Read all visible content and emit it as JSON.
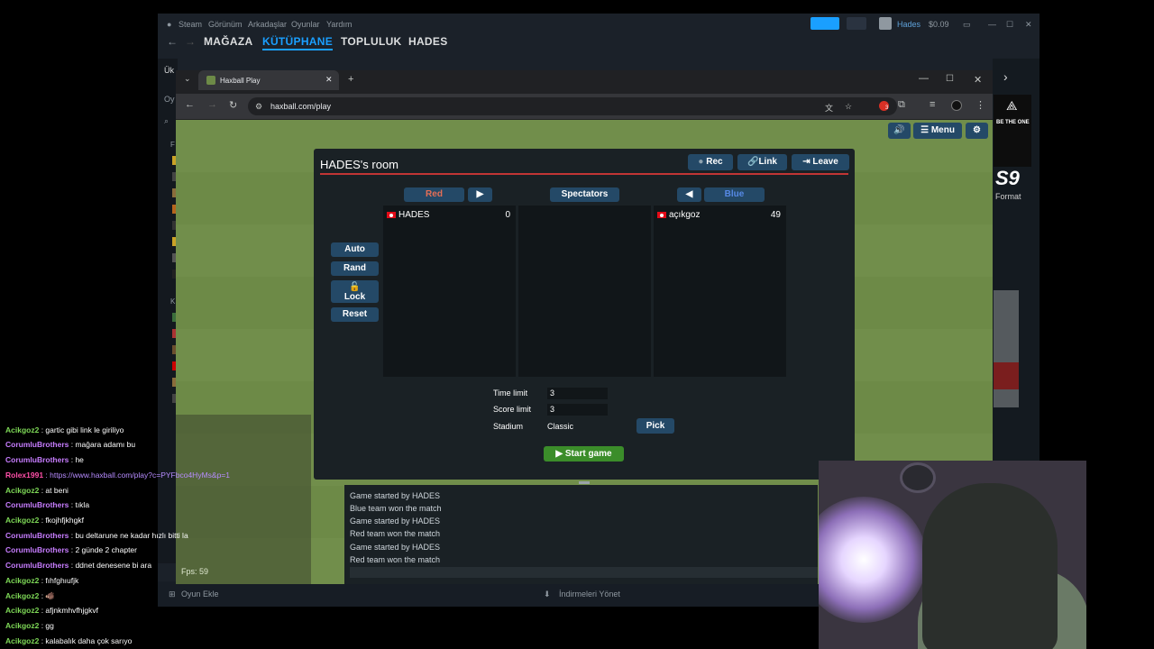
{
  "steam": {
    "menu": [
      "Steam",
      "Görünüm",
      "Arkadaşlar",
      "Oyunlar",
      "Yardım"
    ],
    "nav": [
      "MAĞAZA",
      "KÜTÜPHANE",
      "TOPLULUK",
      "HADES"
    ],
    "user": "Hades",
    "balance": "$0.09",
    "add_game": "Oyun Ekle",
    "downloads": "İndirmeleri Yönet",
    "home_tab": "Ük",
    "side_label_a": "Oy",
    "side_label_b": "F",
    "side_label_c": "K"
  },
  "chrome": {
    "tab_title": "Haxball Play",
    "url": "haxball.com/play",
    "ext_badge": "3"
  },
  "haxball": {
    "top_menu": "Menu",
    "room_title": "HADES's room",
    "rec": "Rec",
    "link": "Link",
    "leave": "Leave",
    "red_label": "Red",
    "blue_label": "Blue",
    "spectators_label": "Spectators",
    "arrow_right": "▶",
    "arrow_left": "◀",
    "red_players": [
      {
        "name": "HADES",
        "score": "0"
      }
    ],
    "blue_players": [
      {
        "name": "açıkgoz",
        "score": "49"
      }
    ],
    "auto": "Auto",
    "rand": "Rand",
    "lock": "Lock",
    "reset": "Reset",
    "time_limit_label": "Time limit",
    "time_limit": "3",
    "score_limit_label": "Score limit",
    "score_limit": "3",
    "stadium_label": "Stadium",
    "stadium": "Classic",
    "pick": "Pick",
    "start_game": "▶ Start game",
    "fps": "Fps: 59",
    "log": [
      "Game started by HADES",
      "Blue team won the match",
      "Game started by HADES",
      "Red team won the match",
      "Game started by HADES",
      "Red team won the match"
    ]
  },
  "chat": [
    {
      "user": "Acikgoz2",
      "text": " : gartic gibi link le giriliyo",
      "color": "#7ed957"
    },
    {
      "user": "CorumluBrothers",
      "text": " : mağara adamı bu",
      "color": "#c77dff"
    },
    {
      "user": "CorumluBrothers",
      "text": " : he",
      "color": "#c77dff"
    },
    {
      "user": "Rolex1991",
      "text": " : https://www.haxball.com/play?c=PYFbco4HyMs&amp;p=1",
      "color": "#ff4fa8"
    },
    {
      "user": "Acikgoz2",
      "text": " : at beni",
      "color": "#7ed957"
    },
    {
      "user": "CorumluBrothers",
      "text": " : tıkla",
      "color": "#c77dff"
    },
    {
      "user": "Acikgoz2",
      "text": " : fkojhfjkhgkf",
      "color": "#7ed957"
    },
    {
      "user": "CorumluBrothers",
      "text": " : bu deltarune ne kadar hızlı bitti la",
      "color": "#c77dff"
    },
    {
      "user": "CorumluBrothers",
      "text": " : 2 günde 2 chapter",
      "color": "#c77dff"
    },
    {
      "user": "CorumluBrothers",
      "text": " : ddnet denesene bi ara",
      "color": "#c77dff"
    },
    {
      "user": "Acikgoz2",
      "text": " : fıhfghıufjk",
      "color": "#7ed957"
    },
    {
      "user": "Acikgoz2",
      "text": " : 🐗",
      "color": "#7ed957"
    },
    {
      "user": "Acikgoz2",
      "text": " : afjnkmhvfhjgkvf",
      "color": "#7ed957"
    },
    {
      "user": "Acikgoz2",
      "text": " : gg",
      "color": "#7ed957"
    },
    {
      "user": "Acikgoz2",
      "text": " : kalabalık daha çok sarıyo",
      "color": "#7ed957"
    }
  ],
  "overlay": {
    "be_the_one": "BE THE ONE",
    "format": "Format",
    "big_s": "S9"
  },
  "colors": {
    "red_team": "#e56e56",
    "blue_team": "#5689e5",
    "button": "#244967",
    "start": "#3b8d2a",
    "pitch": "#6d8a47"
  }
}
